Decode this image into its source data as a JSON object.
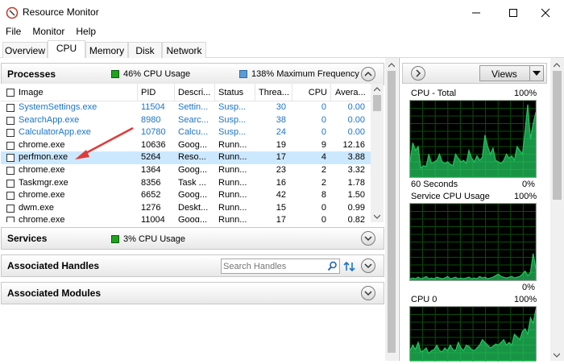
{
  "window": {
    "title": "Resource Monitor"
  },
  "menu": [
    "File",
    "Monitor",
    "Help"
  ],
  "tabs": [
    "Overview",
    "CPU",
    "Memory",
    "Disk",
    "Network"
  ],
  "active_tab": "CPU",
  "processes": {
    "title": "Processes",
    "cpu_usage": "46% CPU Usage",
    "max_frequency": "138% Maximum Frequency",
    "columns": [
      "Image",
      "PID",
      "Descri...",
      "Status",
      "Threa...",
      "CPU",
      "Avera..."
    ],
    "rows": [
      {
        "image": "SystemSettings.exe",
        "pid": "11504",
        "desc": "Settin...",
        "status": "Susp...",
        "threads": "30",
        "cpu": "0",
        "avg": "0.00",
        "suspended": true
      },
      {
        "image": "SearchApp.exe",
        "pid": "8980",
        "desc": "Searc...",
        "status": "Susp...",
        "threads": "38",
        "cpu": "0",
        "avg": "0.00",
        "suspended": true
      },
      {
        "image": "CalculatorApp.exe",
        "pid": "10780",
        "desc": "Calcu...",
        "status": "Susp...",
        "threads": "24",
        "cpu": "0",
        "avg": "0.00",
        "suspended": true
      },
      {
        "image": "chrome.exe",
        "pid": "10636",
        "desc": "Goog...",
        "status": "Runn...",
        "threads": "19",
        "cpu": "9",
        "avg": "12.16",
        "suspended": false
      },
      {
        "image": "perfmon.exe",
        "pid": "5264",
        "desc": "Reso...",
        "status": "Runn...",
        "threads": "17",
        "cpu": "4",
        "avg": "3.88",
        "suspended": false,
        "selected": true
      },
      {
        "image": "chrome.exe",
        "pid": "1364",
        "desc": "Goog...",
        "status": "Runn...",
        "threads": "23",
        "cpu": "2",
        "avg": "3.32",
        "suspended": false
      },
      {
        "image": "Taskmgr.exe",
        "pid": "8356",
        "desc": "Task ...",
        "status": "Runn...",
        "threads": "16",
        "cpu": "2",
        "avg": "1.78",
        "suspended": false
      },
      {
        "image": "chrome.exe",
        "pid": "6652",
        "desc": "Goog...",
        "status": "Runn...",
        "threads": "42",
        "cpu": "8",
        "avg": "1.50",
        "suspended": false
      },
      {
        "image": "dwm.exe",
        "pid": "1276",
        "desc": "Deskt...",
        "status": "Runn...",
        "threads": "15",
        "cpu": "0",
        "avg": "0.99",
        "suspended": false
      },
      {
        "image": "chrome.exe",
        "pid": "11004",
        "desc": "Goog...",
        "status": "Runn...",
        "threads": "17",
        "cpu": "0",
        "avg": "0.82",
        "suspended": false
      }
    ]
  },
  "services": {
    "title": "Services",
    "cpu_usage": "3% CPU Usage"
  },
  "handles": {
    "title": "Associated Handles",
    "search_placeholder": "Search Handles"
  },
  "modules": {
    "title": "Associated Modules"
  },
  "right_panel": {
    "views_label": "Views",
    "graphs": [
      {
        "title": "CPU - Total",
        "top_label": "100%",
        "bottom_left": "60 Seconds",
        "bottom_right": "0%"
      },
      {
        "title": "Service CPU Usage",
        "top_label": "100%",
        "bottom_right": "0%"
      },
      {
        "title": "CPU 0",
        "top_label": "100%"
      }
    ]
  },
  "colors": {
    "accent_blue": "#1c74c7",
    "graph_green": "#22c55e",
    "cpu_icon": "#1fa31f",
    "freq_icon": "#5b9bd5",
    "selected_row": "#cce8ff",
    "annotation_arrow": "#e03a3a"
  }
}
